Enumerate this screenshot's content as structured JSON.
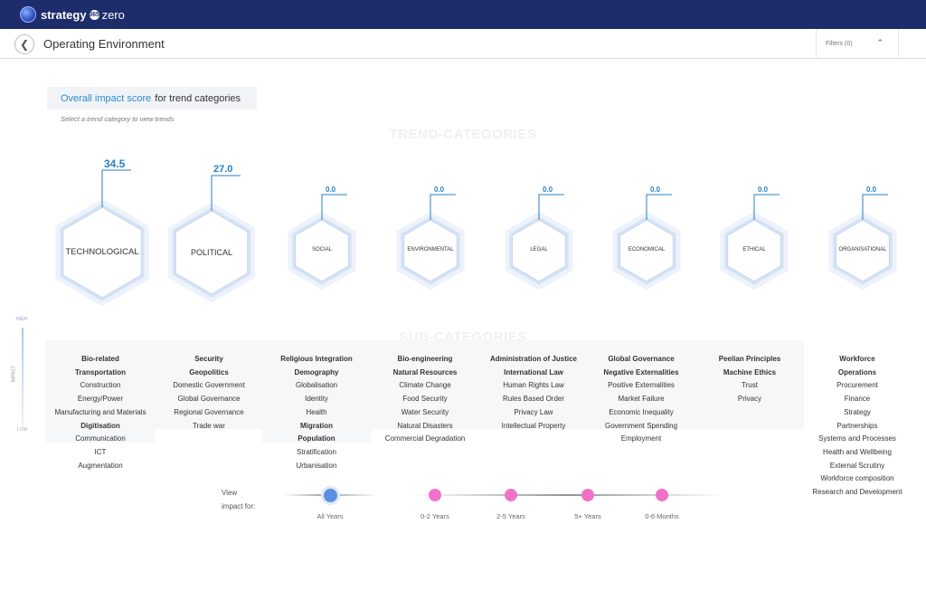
{
  "app": {
    "name": "strategy",
    "badge": "365",
    "name2": "zero"
  },
  "header": {
    "title": "Operating Environment",
    "filters_label": "Filters (0)"
  },
  "score_box": {
    "highlight": "Overall impact score",
    "rest": "for trend categories"
  },
  "hint": "Select a trend category to view trends",
  "sections": {
    "trend_categories": "TREND-CATEGORIES",
    "sub_categories": "SUB-CATEGORIES"
  },
  "impact_scale": {
    "high": "HIGH",
    "mid": "IMPACT",
    "low": "LOW"
  },
  "trends": [
    {
      "label": "TECHNOLOGICAL",
      "score": "34.5"
    },
    {
      "label": "POLITICAL",
      "score": "27.0"
    },
    {
      "label": "SOCIAL",
      "score": "0.0"
    },
    {
      "label": "ENVIRONMENTAL",
      "score": "0.0"
    },
    {
      "label": "LEGAL",
      "score": "0.0"
    },
    {
      "label": "ECONOMICAL",
      "score": "0.0"
    },
    {
      "label": "ETHICAL",
      "score": "0.0"
    },
    {
      "label": "ORGANISATIONAL",
      "score": "0.0"
    }
  ],
  "subcategories": [
    {
      "items": [
        {
          "text": "Bio-related",
          "bold": true
        },
        {
          "text": "Transportation",
          "bold": true
        },
        {
          "text": "Construction",
          "bold": false
        },
        {
          "text": "Energy/Power",
          "bold": false
        },
        {
          "text": "Manufacturing and Materials",
          "bold": false
        },
        {
          "text": "Digitisation",
          "bold": true
        },
        {
          "text": "Communication",
          "bold": false
        },
        {
          "text": "ICT",
          "bold": false
        },
        {
          "text": "Augmentation",
          "bold": false
        }
      ]
    },
    {
      "items": [
        {
          "text": "Security",
          "bold": true
        },
        {
          "text": "Geopolitics",
          "bold": true
        },
        {
          "text": "Domestic Government",
          "bold": false
        },
        {
          "text": "Global Governance",
          "bold": false
        },
        {
          "text": "Regional Governance",
          "bold": false
        },
        {
          "text": "Trade war",
          "bold": false
        }
      ]
    },
    {
      "items": [
        {
          "text": "Religious Integration",
          "bold": true
        },
        {
          "text": "Demography",
          "bold": true
        },
        {
          "text": "Globalisation",
          "bold": false
        },
        {
          "text": "Identity",
          "bold": false
        },
        {
          "text": "Health",
          "bold": false
        },
        {
          "text": "Migration",
          "bold": true
        },
        {
          "text": "Population",
          "bold": true
        },
        {
          "text": "Stratification",
          "bold": false
        },
        {
          "text": "Urbanisation",
          "bold": false
        }
      ]
    },
    {
      "items": [
        {
          "text": "Bio-engineering",
          "bold": true
        },
        {
          "text": "Natural Resources",
          "bold": true
        },
        {
          "text": "Climate Change",
          "bold": false
        },
        {
          "text": "Food Security",
          "bold": false
        },
        {
          "text": "Water Security",
          "bold": false
        },
        {
          "text": "Natural Disasters",
          "bold": false
        },
        {
          "text": "Commercial Degradation",
          "bold": false
        }
      ]
    },
    {
      "items": [
        {
          "text": "Administration of Justice",
          "bold": true
        },
        {
          "text": "International Law",
          "bold": true
        },
        {
          "text": "Human Rights Law",
          "bold": false
        },
        {
          "text": "Rules Based Order",
          "bold": false
        },
        {
          "text": "Privacy Law",
          "bold": false
        },
        {
          "text": "Intellectual Property",
          "bold": false
        }
      ]
    },
    {
      "items": [
        {
          "text": "Global Governance",
          "bold": true
        },
        {
          "text": "Negative Externalities",
          "bold": true
        },
        {
          "text": "Positive Externalities",
          "bold": false
        },
        {
          "text": "Market Failure",
          "bold": false
        },
        {
          "text": "Economic Inequality",
          "bold": false
        },
        {
          "text": "Government Spending",
          "bold": false
        },
        {
          "text": "Employment",
          "bold": false
        }
      ]
    },
    {
      "items": [
        {
          "text": "Peelian Principles",
          "bold": true
        },
        {
          "text": "Machine Ethics",
          "bold": true
        },
        {
          "text": "Trust",
          "bold": false
        },
        {
          "text": "Privacy",
          "bold": false
        }
      ]
    },
    {
      "items": [
        {
          "text": "Workforce",
          "bold": true
        },
        {
          "text": "Operations",
          "bold": true
        },
        {
          "text": "Procurement",
          "bold": false
        },
        {
          "text": "Finance",
          "bold": false
        },
        {
          "text": "Strategy",
          "bold": false
        },
        {
          "text": "Partnerships",
          "bold": false
        },
        {
          "text": "Systems and Processes",
          "bold": false
        },
        {
          "text": "Health and Wellbeing",
          "bold": false
        },
        {
          "text": "External Scrutiny",
          "bold": false
        },
        {
          "text": "Workforce composition",
          "bold": false
        },
        {
          "text": "Research and Development",
          "bold": false
        }
      ]
    }
  ],
  "view_impact": {
    "label_line1": "View",
    "label_line2": "impact for:",
    "options": [
      "All Years",
      "0-2 Years",
      "2-5 Years",
      "5+ Years",
      "0-6 Months"
    ],
    "selected": "All Years"
  },
  "colors": {
    "navy": "#1d2c6b",
    "accent": "#2a7fc5",
    "selected_dot": "#5b8fe0",
    "dot": "#f072c8"
  }
}
